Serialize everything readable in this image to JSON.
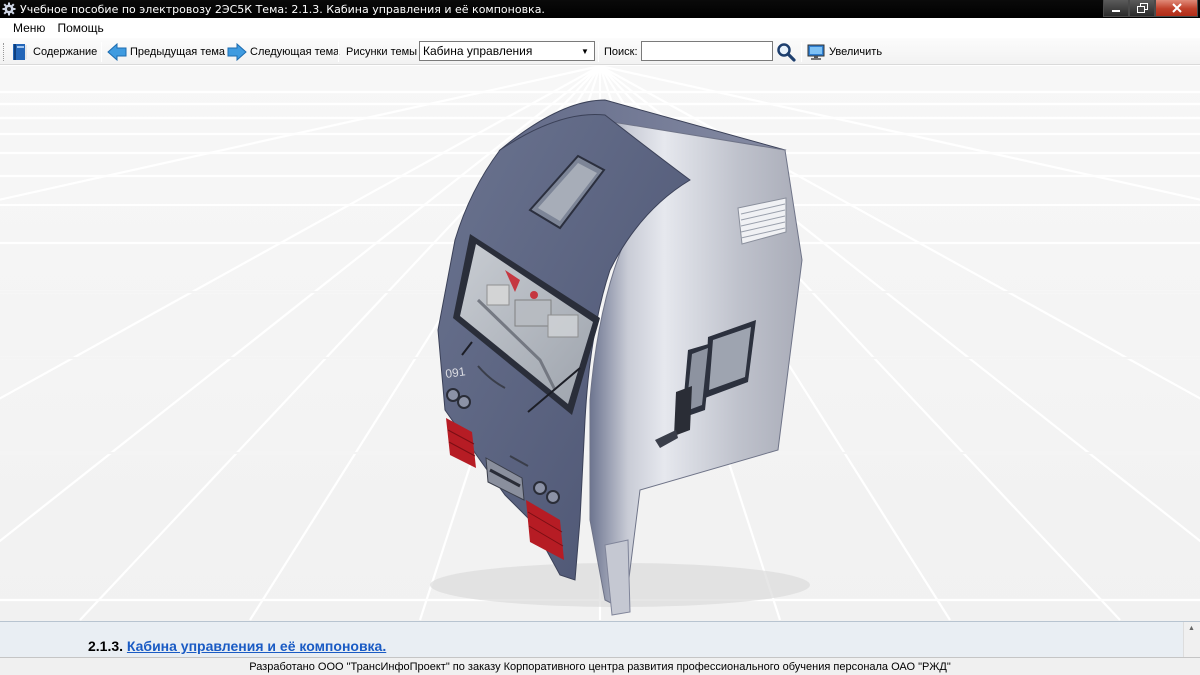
{
  "window": {
    "title": "Учебное пособие по электровозу 2ЭС5К Тема: 2.1.3. Кабина управления и её компоновка."
  },
  "menu": {
    "items": [
      "Меню",
      "Помощь"
    ]
  },
  "toolbar": {
    "contents_label": "Содержание",
    "prev_label": "Предыдущая тема",
    "next_label": "Следующая тема",
    "figures_label": "Рисунки темы",
    "figures_selected": "Кабина управления",
    "search_label": "Поиск:",
    "search_value": "",
    "zoom_label": "Увеличить"
  },
  "viewport": {
    "side_number": "091"
  },
  "topic": {
    "number": "2.1.3.",
    "title": "Кабина управления и её компоновка."
  },
  "status": {
    "text": "Разработано ООО \"ТрансИнфоПроект\" по заказу Корпоративного центра развития профессионального обучения персонала ОАО \"РЖД\""
  }
}
